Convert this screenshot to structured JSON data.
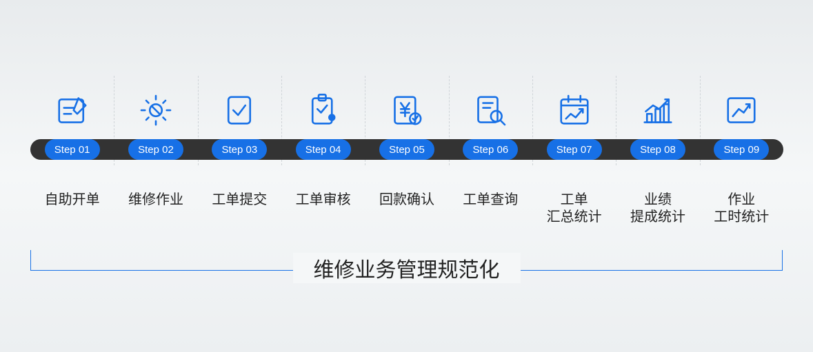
{
  "title": "维修业务管理规范化",
  "steps": [
    {
      "step": "Step 01",
      "label": "自助开单",
      "icon": "edit-note-icon"
    },
    {
      "step": "Step 02",
      "label": "维修作业",
      "icon": "gear-wrench-icon"
    },
    {
      "step": "Step 03",
      "label": "工单提交",
      "icon": "document-check-icon"
    },
    {
      "step": "Step 04",
      "label": "工单审核",
      "icon": "clipboard-lock-icon"
    },
    {
      "step": "Step 05",
      "label": "回款确认",
      "icon": "yen-confirm-icon"
    },
    {
      "step": "Step 06",
      "label": "工单查询",
      "icon": "document-search-icon"
    },
    {
      "step": "Step 07",
      "label": "工单\n汇总统计",
      "icon": "calendar-chart-icon"
    },
    {
      "step": "Step 08",
      "label": "业绩\n提成统计",
      "icon": "bar-trend-icon"
    },
    {
      "step": "Step 09",
      "label": "作业\n工时统计",
      "icon": "line-trend-icon"
    }
  ],
  "colors": {
    "accent": "#1770e6",
    "track": "#333333"
  }
}
